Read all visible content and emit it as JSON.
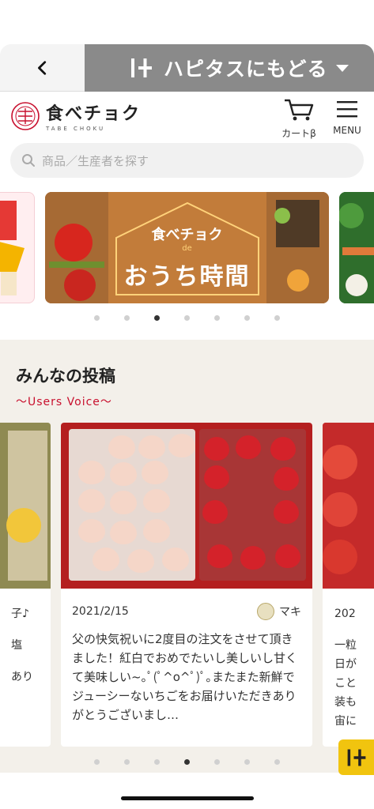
{
  "topbar": {
    "back_icon": "chevron-left-icon",
    "hapitas_label": "ハピタスにもどる"
  },
  "header": {
    "logo_text": "食べチョク",
    "logo_sub": "TABE CHOKU",
    "cart_label": "カートβ",
    "menu_label": "MENU"
  },
  "search": {
    "placeholder": "商品／生産者を探す"
  },
  "banner": {
    "title_top": "食べチョク",
    "title_de": "de",
    "title_main": "おうち時間"
  },
  "banner_dots": {
    "count": 7,
    "active": 2
  },
  "voice": {
    "title": "みんなの投稿",
    "subtitle": "〜Users Voice〜",
    "left_card_lines": [
      "子♪",
      "塩",
      "あり"
    ],
    "main_card": {
      "date": "2021/2/15",
      "user": "マキ",
      "body": "父の快気祝いに2度目の注文をさせて頂きました！紅白でおめでたいし美しいし甘くて美味しい~｡ﾟ(ﾟ^o^ﾟ)ﾟ｡またまた新鮮でジューシーないちごをお届けいただきありがとうございまし…"
    },
    "right_card": {
      "date": "202",
      "lines": [
        "一粒",
        "日が",
        "こと",
        "装も",
        "宙に"
      ]
    }
  },
  "voice_dots": {
    "count": 7,
    "active": 3
  },
  "colors": {
    "hapitas_bar": "#8a8a8a",
    "accent_red": "#c8102e",
    "section_bg": "#f3f0ea",
    "hapitas_yellow": "#f1c40f"
  }
}
